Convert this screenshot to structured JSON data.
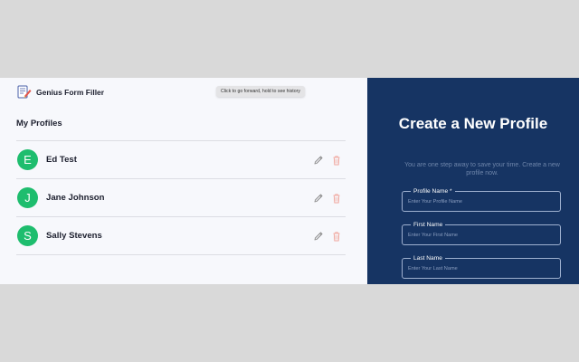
{
  "app": {
    "name": "Genius Form Filler"
  },
  "tooltip": "Click to go forward, hold to see history",
  "profiles_section": {
    "title": "My Profiles",
    "profiles": [
      {
        "initial": "E",
        "name": "Ed Test"
      },
      {
        "initial": "J",
        "name": "Jane Johnson"
      },
      {
        "initial": "S",
        "name": "Sally Stevens"
      }
    ]
  },
  "create_panel": {
    "title": "Create a New Profile",
    "subtitle": "You are one step away to save your time. Create a new profile now.",
    "fields": [
      {
        "label": "Profile Name *",
        "placeholder": "Enter Your Profile Name"
      },
      {
        "label": "First Name",
        "placeholder": "Enter Your First Name"
      },
      {
        "label": "Last Name",
        "placeholder": "Enter Your Last Name"
      }
    ]
  },
  "colors": {
    "background": "#d9d9d9",
    "left_panel": "#f7f8fc",
    "right_panel": "#163463",
    "avatar": "#1ebd6e",
    "delete_icon": "#f0a59c",
    "edit_icon": "#8a8a8a"
  },
  "icons": [
    "app-logo-icon",
    "edit-icon",
    "trash-icon"
  ]
}
